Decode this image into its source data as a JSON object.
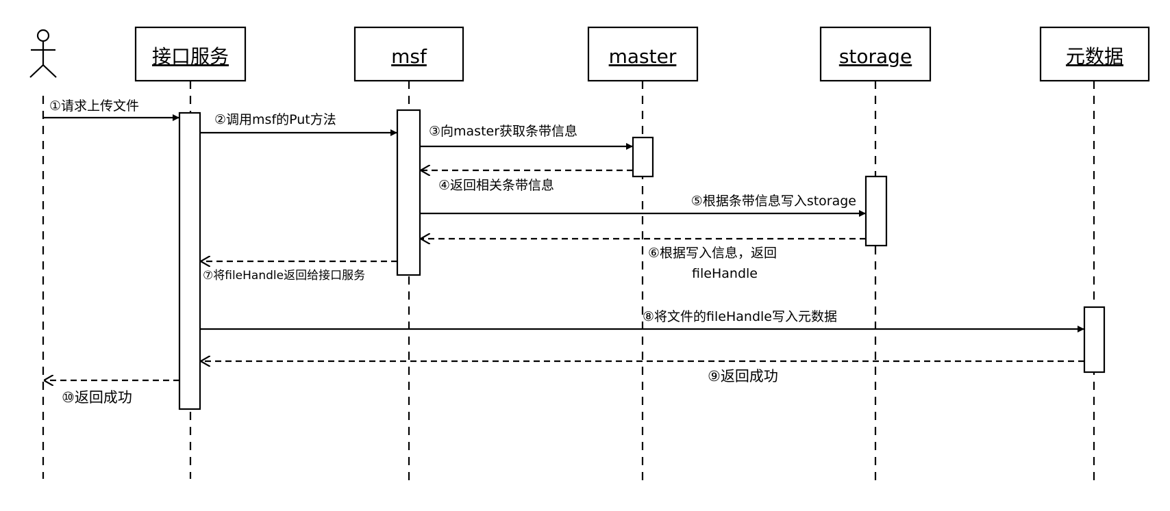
{
  "participants": [
    {
      "id": "user",
      "label": "",
      "kind": "actor"
    },
    {
      "id": "api",
      "label": "接口服务"
    },
    {
      "id": "msf",
      "label": "msf"
    },
    {
      "id": "master",
      "label": "master"
    },
    {
      "id": "storage",
      "label": "storage"
    },
    {
      "id": "meta",
      "label": "元数据"
    }
  ],
  "messages": [
    {
      "from": "user",
      "to": "api",
      "style": "solid",
      "label": [
        "①请求上传文件"
      ]
    },
    {
      "from": "api",
      "to": "msf",
      "style": "solid",
      "label": [
        "②调用msf的Put方法"
      ]
    },
    {
      "from": "msf",
      "to": "master",
      "style": "solid",
      "label": [
        "③向master获取条带信息"
      ]
    },
    {
      "from": "master",
      "to": "msf",
      "style": "dashed",
      "label": [
        "④返回相关条带信息"
      ]
    },
    {
      "from": "msf",
      "to": "storage",
      "style": "solid",
      "label": [
        "⑤根据条带信息写入storage"
      ]
    },
    {
      "from": "storage",
      "to": "msf",
      "style": "dashed",
      "label": [
        "⑥根据写入信息，返回",
        "fileHandle"
      ]
    },
    {
      "from": "msf",
      "to": "api",
      "style": "dashed",
      "label": [
        "⑦将fileHandle返回给接口服务"
      ]
    },
    {
      "from": "api",
      "to": "meta",
      "style": "solid",
      "label": [
        "⑧将文件的fileHandle写入元数据"
      ]
    },
    {
      "from": "meta",
      "to": "api",
      "style": "dashed",
      "label": [
        "⑨返回成功"
      ]
    },
    {
      "from": "api",
      "to": "user",
      "style": "dashed",
      "label": [
        "⑩返回成功"
      ]
    }
  ]
}
